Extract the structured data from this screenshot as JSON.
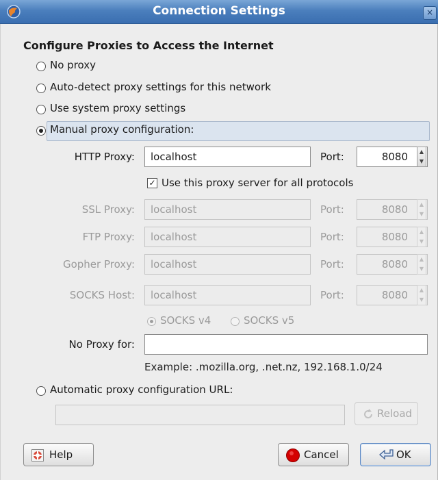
{
  "window": {
    "title": "Connection Settings",
    "close_label": "×",
    "scrap_text": "— — — — — — — —"
  },
  "heading": "Configure Proxies to Access the Internet",
  "proxy_options": {
    "none": "No proxy",
    "autodetect": "Auto-detect proxy settings for this network",
    "system": "Use system proxy settings",
    "manual": "Manual proxy configuration:",
    "auto_url": "Automatic proxy configuration URL:",
    "selected": "manual"
  },
  "manual": {
    "http": {
      "label": "HTTP Proxy:",
      "value": "localhost",
      "port_label": "Port:",
      "port": "8080"
    },
    "use_for_all": {
      "label": "Use this proxy server for all protocols",
      "checked": true
    },
    "ssl": {
      "label": "SSL Proxy:",
      "value": "localhost",
      "port_label": "Port:",
      "port": "8080"
    },
    "ftp": {
      "label": "FTP Proxy:",
      "value": "localhost",
      "port_label": "Port:",
      "port": "8080"
    },
    "gopher": {
      "label": "Gopher Proxy:",
      "value": "localhost",
      "port_label": "Port:",
      "port": "8080"
    },
    "socks": {
      "label": "SOCKS Host:",
      "value": "localhost",
      "port_label": "Port:",
      "port": "8080"
    },
    "socks_v4": "SOCKS v4",
    "socks_v5": "SOCKS v5",
    "socks_version": "v4",
    "no_proxy_label": "No Proxy for:",
    "no_proxy_value": "",
    "example": "Example: .mozilla.org, .net.nz, 192.168.1.0/24"
  },
  "auto_url_value": "",
  "buttons": {
    "reload": "Reload",
    "help": "Help",
    "cancel": "Cancel",
    "ok": "OK"
  },
  "icons": {
    "app": "firefox-globe-icon",
    "help": "lifebuoy-icon",
    "cancel": "red-stop-icon",
    "ok": "ok-arrow-icon",
    "reload": "reload-icon"
  },
  "colors": {
    "titlebar": "#3a6eb0",
    "selection": "#dbe4ef",
    "cancel_icon": "#d40000"
  }
}
